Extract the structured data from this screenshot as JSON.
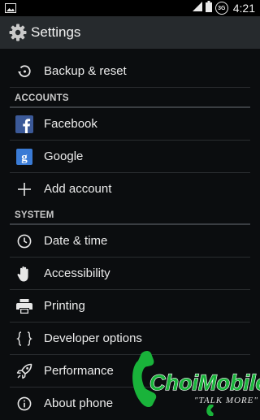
{
  "status_bar": {
    "time": "4:21",
    "network": "3G"
  },
  "action_bar": {
    "title": "Settings",
    "icon": "gear-icon"
  },
  "items_top": [
    {
      "label": "Backup & reset",
      "icon": "backup-restore-icon"
    }
  ],
  "accounts": {
    "header": "ACCOUNTS",
    "items": [
      {
        "label": "Facebook",
        "icon": "facebook-icon"
      },
      {
        "label": "Google",
        "icon": "google-icon"
      },
      {
        "label": "Add account",
        "icon": "plus-icon"
      }
    ]
  },
  "system": {
    "header": "SYSTEM",
    "items": [
      {
        "label": "Date & time",
        "icon": "clock-icon"
      },
      {
        "label": "Accessibility",
        "icon": "hand-icon"
      },
      {
        "label": "Printing",
        "icon": "printer-icon"
      },
      {
        "label": "Developer options",
        "icon": "braces-icon"
      },
      {
        "label": "Performance",
        "icon": "rocket-icon"
      },
      {
        "label": "About phone",
        "icon": "info-icon"
      }
    ]
  },
  "watermark": {
    "brand": "ChoiMobile",
    "tagline": "\"TALK MORE\""
  },
  "colors": {
    "background": "#0b0d0f",
    "action_bar": "#262a2d",
    "divider": "#2a2d30",
    "section_rule": "#3a3e42",
    "facebook_blue": "#3b5998",
    "google_blue": "#3a7bd5",
    "watermark_green": "#19b33a"
  }
}
